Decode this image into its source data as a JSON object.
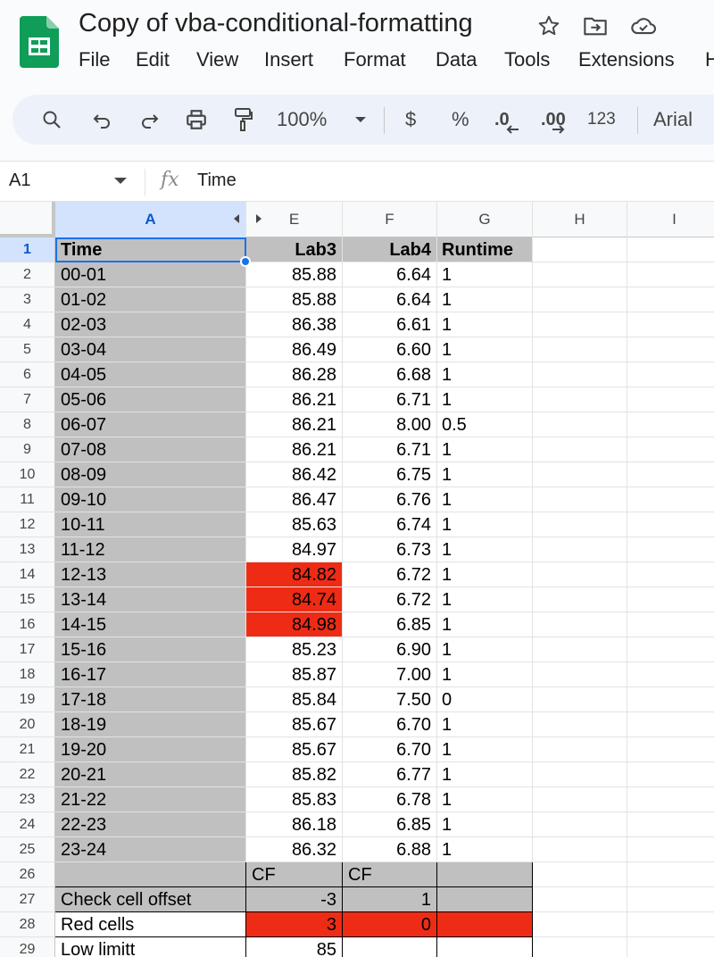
{
  "app": {
    "doc_title": "Copy of vba-conditional-formatting",
    "menu": [
      "File",
      "Edit",
      "View",
      "Insert",
      "Format",
      "Data",
      "Tools",
      "Extensions",
      "H"
    ],
    "title_icons": [
      "star-icon",
      "move-to-folder-icon",
      "cloud-saved-icon"
    ]
  },
  "toolbar": {
    "zoom": "100%",
    "currency": "$",
    "percent": "%",
    "decrease_decimal": ".0",
    "increase_decimal": ".00",
    "number_format": "123",
    "font": "Arial",
    "icons": [
      "search-icon",
      "undo-icon",
      "redo-icon",
      "print-icon",
      "paint-format-icon"
    ]
  },
  "formula_bar": {
    "name_box": "A1",
    "fx": "fx",
    "value": "Time"
  },
  "columns": [
    "A",
    "E",
    "F",
    "G",
    "H",
    "I"
  ],
  "selected_column": "A",
  "selected_row": "1",
  "rows": [
    {
      "n": "1",
      "A": "Time",
      "E": "Lab3",
      "F": "Lab4",
      "G": "Runtime",
      "header": true
    },
    {
      "n": "2",
      "A": "00-01",
      "E": "85.88",
      "F": "6.64",
      "G": "1"
    },
    {
      "n": "3",
      "A": "01-02",
      "E": "85.88",
      "F": "6.64",
      "G": "1"
    },
    {
      "n": "4",
      "A": "02-03",
      "E": "86.38",
      "F": "6.61",
      "G": "1"
    },
    {
      "n": "5",
      "A": "03-04",
      "E": "86.49",
      "F": "6.60",
      "G": "1"
    },
    {
      "n": "6",
      "A": "04-05",
      "E": "86.28",
      "F": "6.68",
      "G": "1"
    },
    {
      "n": "7",
      "A": "05-06",
      "E": "86.21",
      "F": "6.71",
      "G": "1"
    },
    {
      "n": "8",
      "A": "06-07",
      "E": "86.21",
      "F": "8.00",
      "G": "0.5"
    },
    {
      "n": "9",
      "A": "07-08",
      "E": "86.21",
      "F": "6.71",
      "G": "1"
    },
    {
      "n": "10",
      "A": "08-09",
      "E": "86.42",
      "F": "6.75",
      "G": "1"
    },
    {
      "n": "11",
      "A": "09-10",
      "E": "86.47",
      "F": "6.76",
      "G": "1"
    },
    {
      "n": "12",
      "A": "10-11",
      "E": "85.63",
      "F": "6.74",
      "G": "1"
    },
    {
      "n": "13",
      "A": "11-12",
      "E": "84.97",
      "F": "6.73",
      "G": "1"
    },
    {
      "n": "14",
      "A": "12-13",
      "E": "84.82",
      "F": "6.72",
      "G": "1",
      "E_red": true
    },
    {
      "n": "15",
      "A": "13-14",
      "E": "84.74",
      "F": "6.72",
      "G": "1",
      "E_red": true
    },
    {
      "n": "16",
      "A": "14-15",
      "E": "84.98",
      "F": "6.85",
      "G": "1",
      "E_red": true
    },
    {
      "n": "17",
      "A": "15-16",
      "E": "85.23",
      "F": "6.90",
      "G": "1"
    },
    {
      "n": "18",
      "A": "16-17",
      "E": "85.87",
      "F": "7.00",
      "G": "1"
    },
    {
      "n": "19",
      "A": "17-18",
      "E": "85.84",
      "F": "7.50",
      "G": "0"
    },
    {
      "n": "20",
      "A": "18-19",
      "E": "85.67",
      "F": "6.70",
      "G": "1"
    },
    {
      "n": "21",
      "A": "19-20",
      "E": "85.67",
      "F": "6.70",
      "G": "1"
    },
    {
      "n": "22",
      "A": "20-21",
      "E": "85.82",
      "F": "6.77",
      "G": "1"
    },
    {
      "n": "23",
      "A": "21-22",
      "E": "85.83",
      "F": "6.78",
      "G": "1"
    },
    {
      "n": "24",
      "A": "22-23",
      "E": "86.18",
      "F": "6.85",
      "G": "1"
    },
    {
      "n": "25",
      "A": "23-24",
      "E": "86.32",
      "F": "6.88",
      "G": "1"
    },
    {
      "n": "26",
      "A": "",
      "E": "CF",
      "F": "CF",
      "G": "",
      "summary": "cf"
    },
    {
      "n": "27",
      "A": "Check cell offset",
      "E": "-3",
      "F": "1",
      "G": "",
      "summary": "offset"
    },
    {
      "n": "28",
      "A": "Red cells",
      "E": "3",
      "F": "0",
      "G": "",
      "summary": "red"
    },
    {
      "n": "29",
      "A": "Low limitt",
      "E": "85",
      "F": "",
      "G": "",
      "summary": "low"
    }
  ],
  "colors": {
    "header_fill": "#c0c0c0",
    "highlight_red": "#ee2c15",
    "selection_blue": "#1a73e8",
    "sheets_green": "#0f9d58"
  }
}
